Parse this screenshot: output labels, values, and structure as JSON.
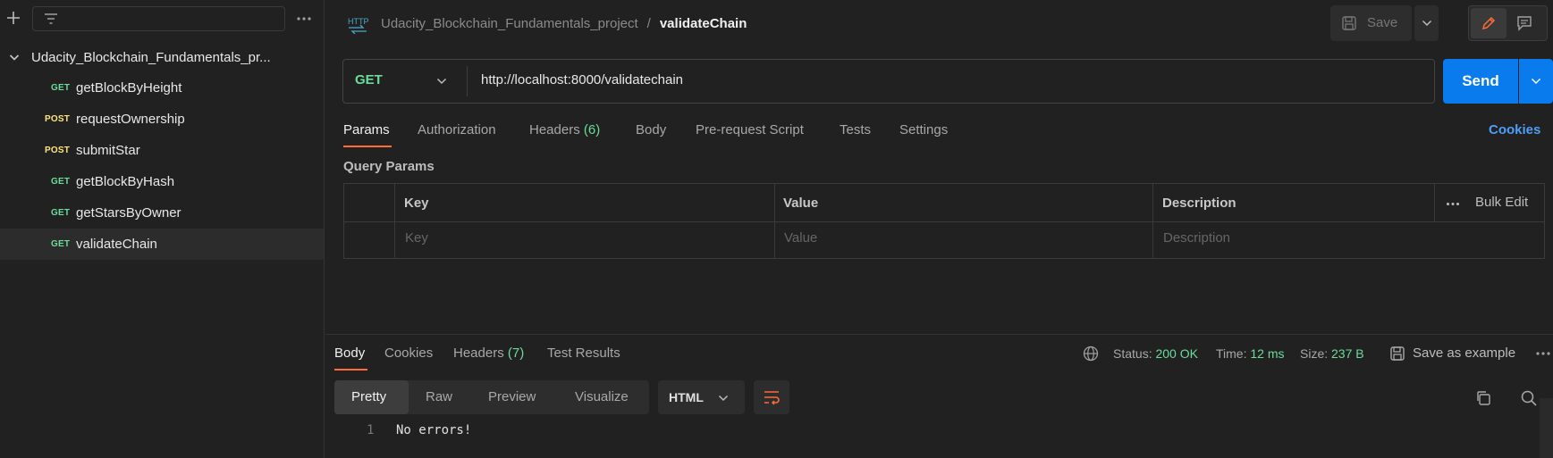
{
  "sidebar": {
    "collection_name": "Udacity_Blockchain_Fundamentals_pr...",
    "requests": [
      {
        "method": "GET",
        "name": "getBlockByHeight"
      },
      {
        "method": "POST",
        "name": "requestOwnership"
      },
      {
        "method": "POST",
        "name": "submitStar"
      },
      {
        "method": "GET",
        "name": "getBlockByHash"
      },
      {
        "method": "GET",
        "name": "getStarsByOwner"
      },
      {
        "method": "GET",
        "name": "validateChain"
      }
    ]
  },
  "header": {
    "collection": "Udacity_Blockchain_Fundamentals_project",
    "separator": "/",
    "request_name": "validateChain",
    "save_label": "Save"
  },
  "request": {
    "method": "GET",
    "url": "http://localhost:8000/validatechain",
    "send_label": "Send",
    "tabs": {
      "params": "Params",
      "authorization": "Authorization",
      "headers": "Headers",
      "headers_count": "(6)",
      "body": "Body",
      "prerequest": "Pre-request Script",
      "tests": "Tests",
      "settings": "Settings"
    },
    "cookies_label": "Cookies",
    "query_params_label": "Query Params",
    "table": {
      "columns": [
        "Key",
        "Value",
        "Description"
      ],
      "placeholders": [
        "Key",
        "Value",
        "Description"
      ],
      "bulk_edit": "Bulk Edit"
    }
  },
  "response": {
    "tabs": {
      "body": "Body",
      "cookies": "Cookies",
      "headers": "Headers",
      "headers_count": "(7)",
      "tests": "Test Results"
    },
    "status_label": "Status:",
    "status_value": "200 OK",
    "time_label": "Time:",
    "time_value": "12 ms",
    "size_label": "Size:",
    "size_value": "237 B",
    "save_example": "Save as example",
    "views": [
      "Pretty",
      "Raw",
      "Preview",
      "Visualize"
    ],
    "format": "HTML",
    "line_number": "1",
    "body_text": "No errors!"
  },
  "colors": {
    "get": "#6bdd9a",
    "post": "#ffe47e",
    "accent": "#ff6c37",
    "send": "#097bed",
    "link": "#4d9ff5"
  }
}
